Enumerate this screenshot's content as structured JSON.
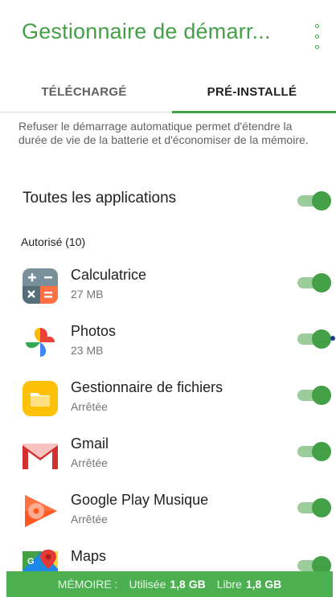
{
  "header": {
    "title": "Gestionnaire de démarr..."
  },
  "tabs": [
    {
      "label": "TÉLÉCHARGÉ",
      "selected": false
    },
    {
      "label": "PRÉ-INSTALLÉ",
      "selected": true
    }
  ],
  "description": "Refuser le démarrage automatique permet d'étendre la durée de vie de la batterie et d'économiser de la mémoire.",
  "all_apps": {
    "label": "Toutes les applications",
    "enabled": true
  },
  "section": {
    "label": "Autorisé (10)"
  },
  "apps": [
    {
      "name": "Calculatrice",
      "sub": "27 MB",
      "icon": "calculator-icon",
      "enabled": true
    },
    {
      "name": "Photos",
      "sub": "23 MB",
      "icon": "photos-pinwheel-icon",
      "enabled": true
    },
    {
      "name": "Gestionnaire de fichiers",
      "sub": "Arrêtée",
      "icon": "folder-icon",
      "enabled": true
    },
    {
      "name": "Gmail",
      "sub": "Arrêtée",
      "icon": "gmail-icon",
      "enabled": true
    },
    {
      "name": "Google Play Musique",
      "sub": "Arrêtée",
      "icon": "play-music-icon",
      "enabled": true
    },
    {
      "name": "Maps",
      "sub": "",
      "icon": "maps-icon",
      "enabled": true
    }
  ],
  "footer": {
    "memory_label": "MÉMOIRE :",
    "used_label": "Utilisée",
    "used_value": "1,8 GB",
    "free_label": "Libre",
    "free_value": "1,8 GB"
  },
  "colors": {
    "accent": "#43a047",
    "footer_bg": "#4caf50",
    "toggle_track": "#9ccc9c"
  }
}
